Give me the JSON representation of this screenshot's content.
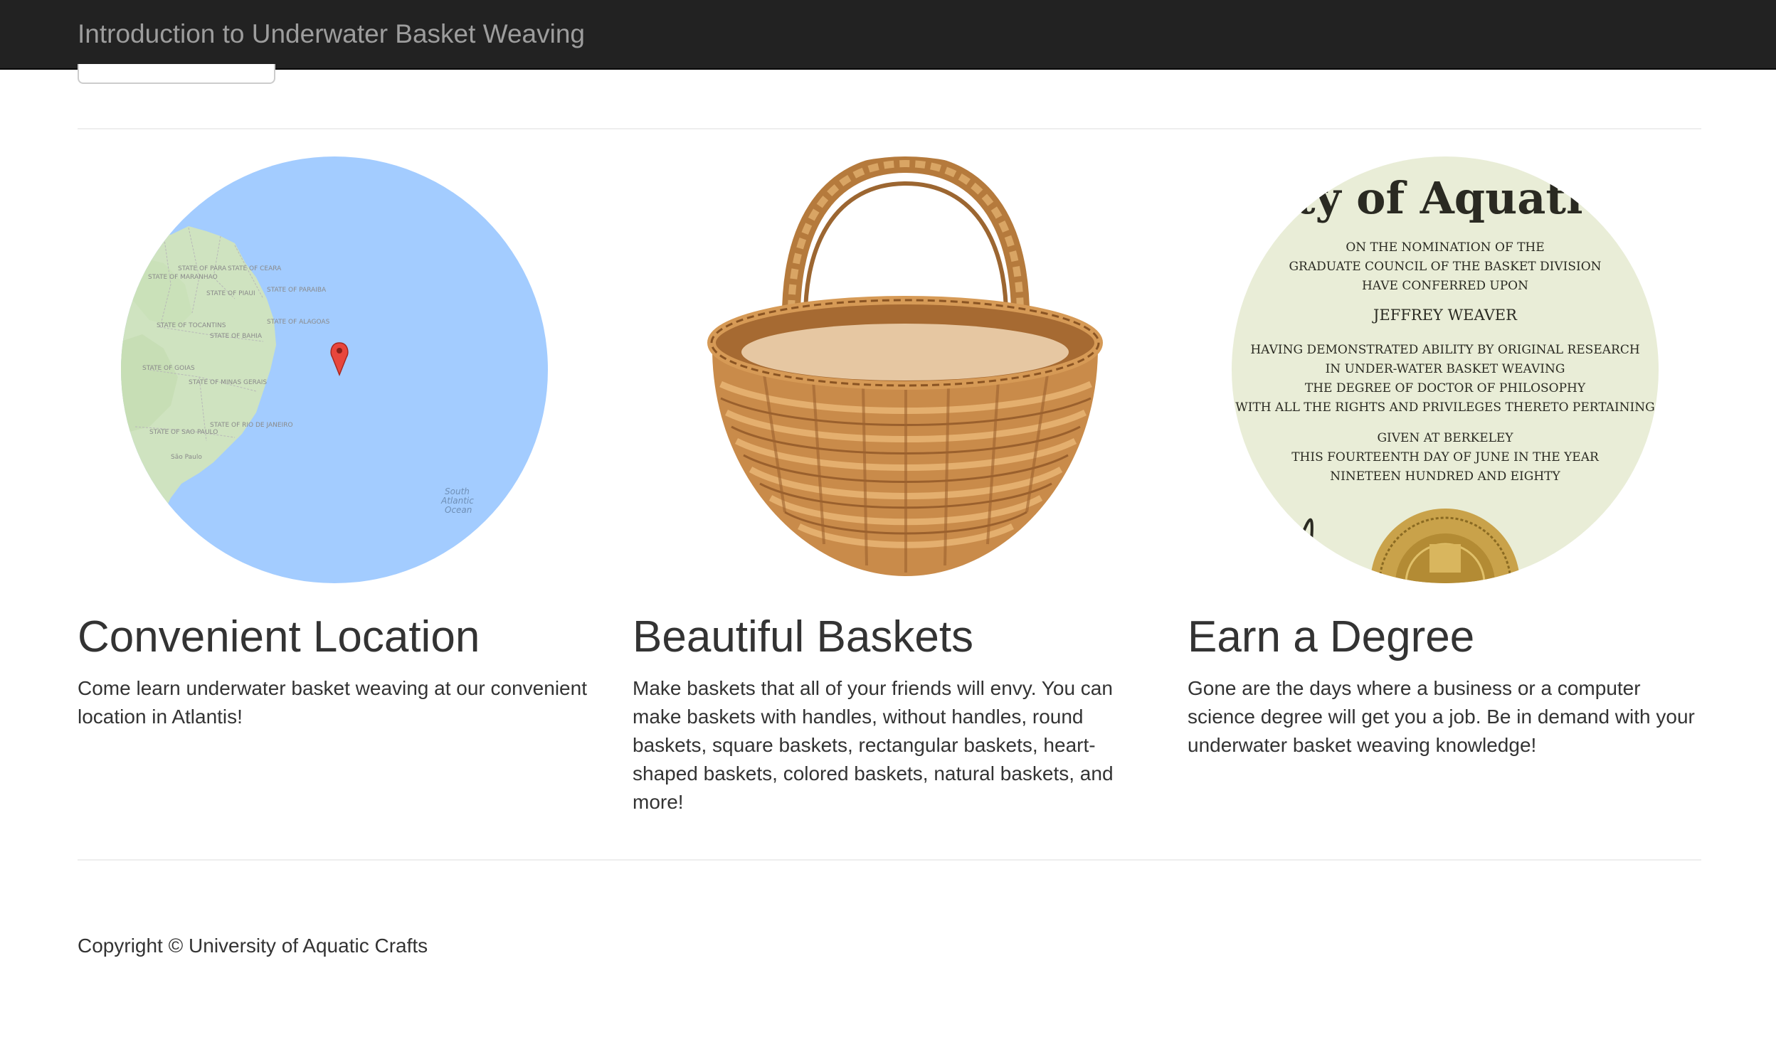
{
  "navbar": {
    "brand": "Introduction to Underwater Basket Weaving"
  },
  "features": [
    {
      "title": "Convenient Location",
      "description": "Come learn underwater basket weaving at our convenient location in Atlantis!",
      "image_icon": "map-icon",
      "map": {
        "labels": [
          "STATE OF PARA",
          "STATE OF MARANHAO",
          "STATE OF CEARA",
          "STATE OF PIAUI",
          "STATE OF PARAIBA",
          "STATE OF TOCANTINS",
          "STATE OF ALAGOAS",
          "STATE OF BAHIA",
          "STATE OF GOIAS",
          "STATE OF MINAS GERAIS",
          "STATE OF SAO PAULO",
          "STATE OF RIO DE JANEIRO",
          "São Paulo",
          "South",
          "Atlantic",
          "Ocean"
        ]
      }
    },
    {
      "title": "Beautiful Baskets",
      "description": "Make baskets that all of your friends will envy. You can make baskets with handles, without handles, round baskets, square baskets, rectangular baskets, heart-shaped baskets, colored baskets, natural baskets, and more!",
      "image_icon": "basket-icon"
    },
    {
      "title": "Earn a Degree",
      "description": "Gone are the days where a business or a computer science degree will get you a job. Be in demand with your underwater basket weaving knowledge!",
      "image_icon": "diploma-icon",
      "diploma": {
        "header": "rsity of Aquatic C",
        "lines": [
          "ON THE NOMINATION OF THE",
          "GRADUATE COUNCIL OF THE BASKET DIVISION",
          "HAVE CONFERRED UPON",
          "JEFFREY WEAVER",
          "HAVING DEMONSTRATED ABILITY BY ORIGINAL RESEARCH",
          "IN UNDER-WATER BASKET WEAVING",
          "THE DEGREE OF DOCTOR OF PHILOSOPHY",
          "WITH ALL THE RIGHTS AND PRIVILEGES THERETO PERTAINING",
          "GIVEN AT BERKELEY",
          "THIS FOURTEENTH DAY OF JUNE IN THE YEAR",
          "NINETEEN HUNDRED AND EIGHTY"
        ]
      }
    }
  ],
  "footer": {
    "copyright": "Copyright © University of Aquatic Crafts"
  },
  "colors": {
    "navbar_bg": "#222222",
    "brand_text": "#9d9d9d",
    "ocean": "#a3ccff",
    "land": "#cfe3c0",
    "pin": "#e8463c",
    "diploma_paper": "#e9edd7",
    "seal_gold": "#c9a24a"
  }
}
